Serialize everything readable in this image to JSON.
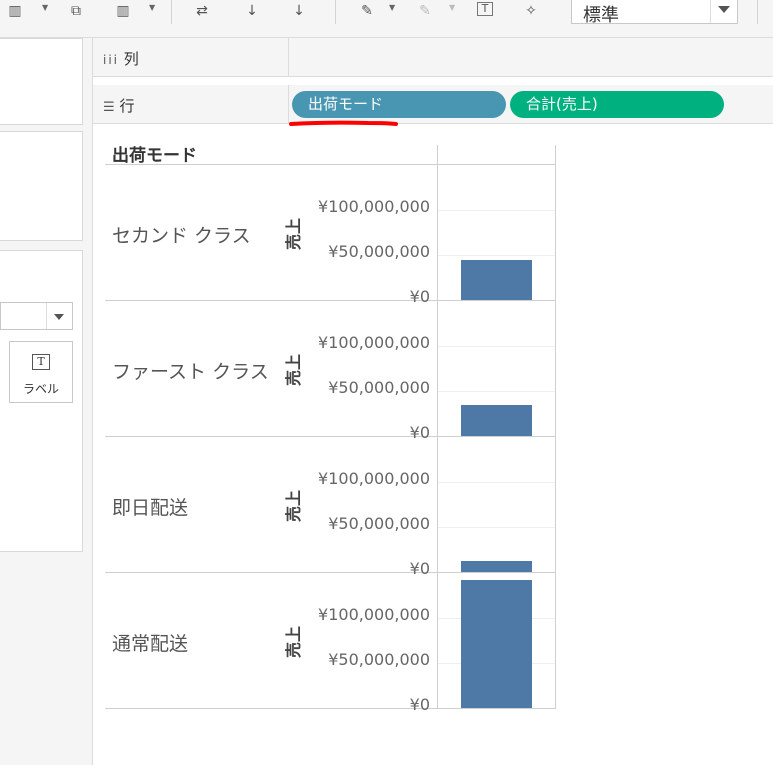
{
  "toolbar": {
    "fit_value": "標準"
  },
  "left_panel": {
    "label_button": "ラベル"
  },
  "shelves": {
    "columns_label": "列",
    "rows_label": "行",
    "rows_pills": [
      {
        "label": "出荷モード",
        "color": "#4996b2"
      },
      {
        "label": "合計(売上)",
        "color": "#00b180"
      }
    ]
  },
  "view": {
    "row_header_title": "出荷モード",
    "axis_title": "売上"
  },
  "chart_data": {
    "type": "bar",
    "categories": [
      "セカンド クラス",
      "ファースト クラス",
      "即日配送",
      "通常配送"
    ],
    "values": [
      45000000,
      35000000,
      12000000,
      150000000
    ],
    "ylabel": "売上",
    "ylim": [
      0,
      125000000
    ],
    "yticks": [
      0,
      50000000,
      100000000
    ],
    "ytick_labels": [
      "¥0",
      "¥50,000,000",
      "¥100,000,000"
    ],
    "bar_color": "#4e79a7",
    "grid": true
  }
}
